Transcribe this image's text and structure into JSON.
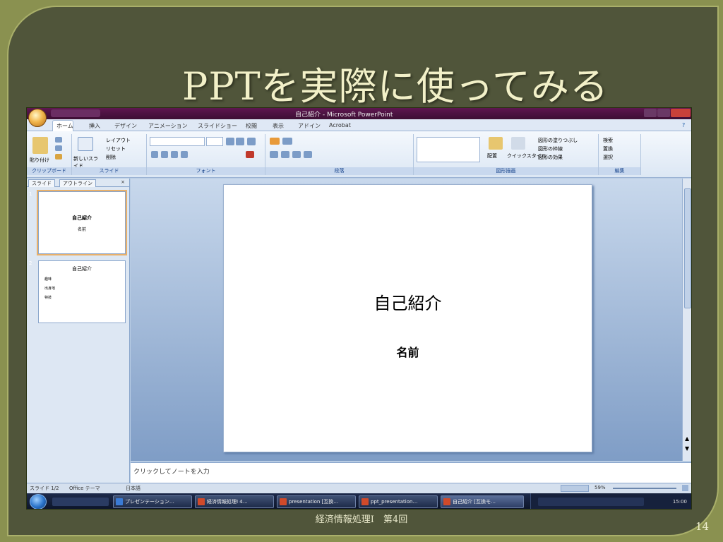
{
  "slide": {
    "title": "PPTを実際に使ってみる",
    "footer": "経済情報処理Ⅰ　第4回",
    "page_number": "14"
  },
  "ppt_window": {
    "title": "自己紹介 - Microsoft PowerPoint",
    "menu_tabs": [
      "ホーム",
      "挿入",
      "デザイン",
      "アニメーション",
      "スライドショー",
      "校閲",
      "表示",
      "アドイン",
      "Acrobat"
    ],
    "ribbon_groups": [
      "クリップボード",
      "スライド",
      "フォント",
      "段落",
      "図形描画",
      "編集"
    ],
    "ribbon_buttons": {
      "paste": "貼り付け",
      "new_slide": "新しいスライド",
      "layout": "レイアウト",
      "reset": "リセット",
      "delete": "削除",
      "arrange": "配置",
      "quick_styles": "クイックスタイル",
      "shape_fill": "図形の塗りつぶし",
      "shape_outline": "図形の枠線",
      "shape_effects": "図形の効果",
      "find": "検索",
      "replace": "置換",
      "select": "選択"
    },
    "pane_tabs": [
      "スライド",
      "アウトライン"
    ],
    "thumbnails": [
      {
        "num": "1",
        "title": "自己紹介",
        "sub": "名前"
      },
      {
        "num": "2",
        "title": "自己紹介",
        "bullets": [
          "趣味",
          "出身地",
          "特技"
        ]
      }
    ],
    "main_slide": {
      "title": "自己紹介",
      "subtitle": "名前"
    },
    "notes_placeholder": "クリックしてノートを入力",
    "status": {
      "slide_counter": "スライド 1/2",
      "theme": "Office テーマ",
      "language": "日本語",
      "zoom": "59%"
    }
  },
  "taskbar": {
    "items": [
      "プレゼンテーション…",
      "経済情報処理Ⅰ 4…",
      "presentation [互換…",
      "ppt_presentation…",
      "自己紹介 [互換モ…"
    ],
    "active_index": 4,
    "clock": "15:00"
  }
}
